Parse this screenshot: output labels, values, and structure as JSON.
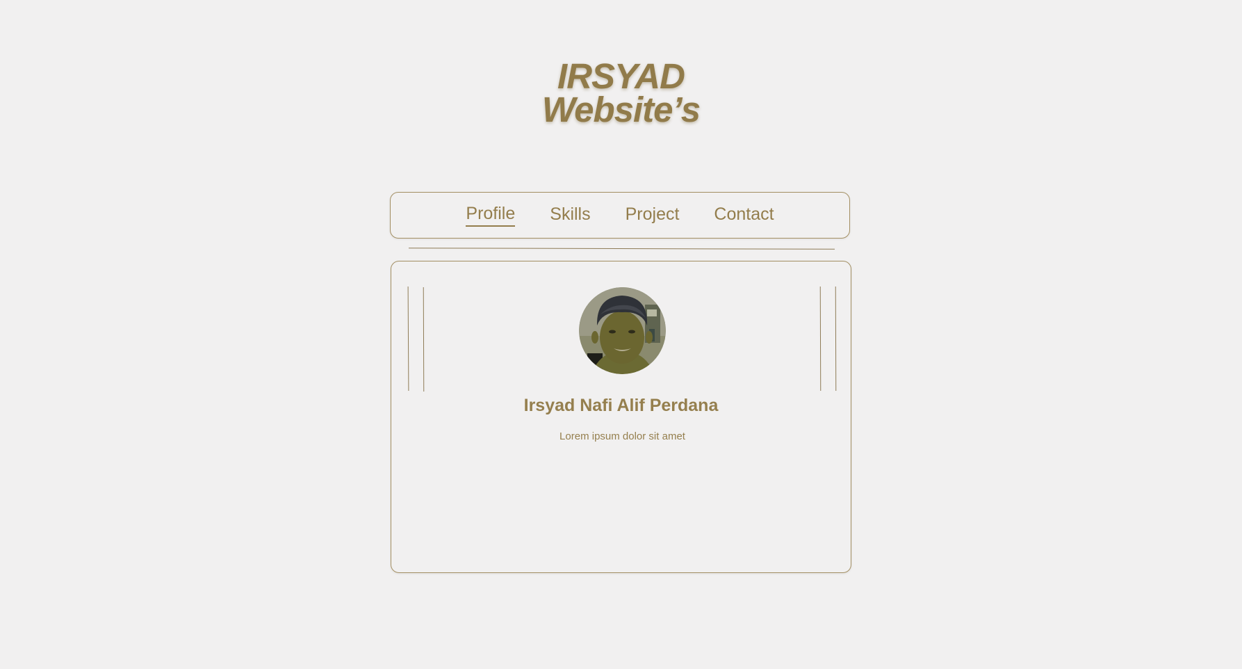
{
  "header": {
    "title_line1": "IRSYAD",
    "title_line2": "Website’s"
  },
  "nav": {
    "items": [
      {
        "label": "Profile",
        "active": true
      },
      {
        "label": "Skills",
        "active": false
      },
      {
        "label": "Project",
        "active": false
      },
      {
        "label": "Contact",
        "active": false
      }
    ]
  },
  "profile": {
    "name": "Irsyad Nafi Alif Perdana",
    "description": "Lorem ipsum dolor sit amet",
    "avatar_icon": "profile-photo"
  },
  "theme": {
    "accent": "#957f4e",
    "background": "#f1f0f0",
    "border": "#a38f63"
  }
}
